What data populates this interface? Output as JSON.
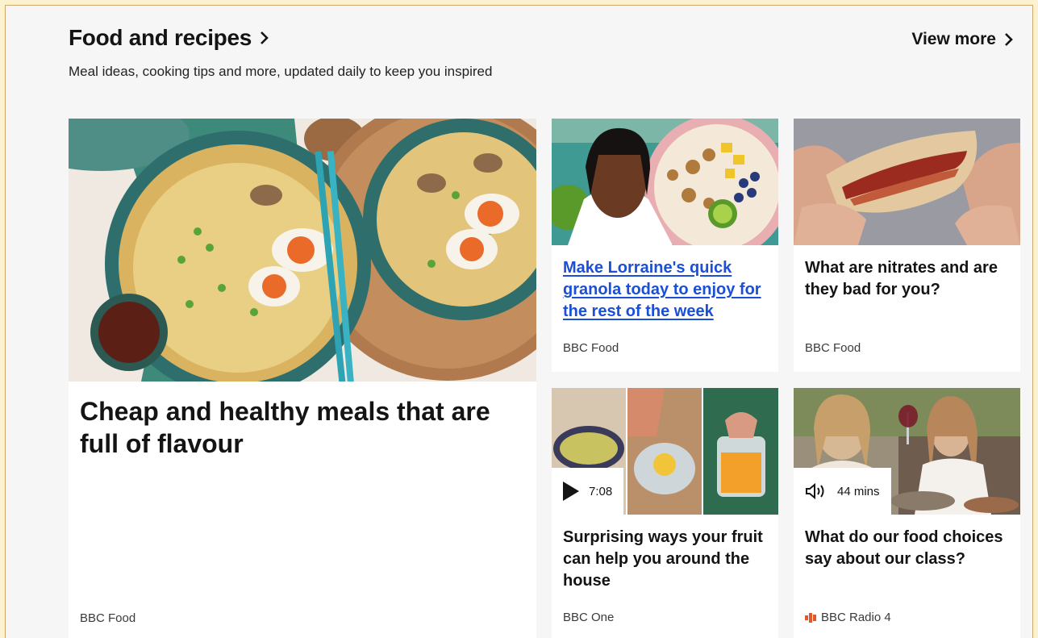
{
  "section": {
    "title": "Food and recipes",
    "subtitle": "Meal ideas, cooking tips and more, updated daily to keep you inspired",
    "view_more": "View more"
  },
  "cards": [
    {
      "headline": "Cheap and healthy meals that are full of flavour",
      "source": "BBC Food",
      "image": "two bowls of ramen with eggs and chopsticks"
    },
    {
      "headline": "Make Lorraine's quick granola today to enjoy for the rest of the week",
      "source": "BBC Food",
      "image": "woman next to a bowl of granola and fruit"
    },
    {
      "headline": "What are nitrates and are they bad for you?",
      "source": "BBC Food",
      "image": "hands holding a bacon sandwich"
    },
    {
      "headline": "Surprising ways your fruit can help you around the house",
      "source": "BBC One",
      "media": "7:08",
      "media_icon": "play-icon",
      "image": "bowls and jars with lemons and orange peel"
    },
    {
      "headline": "What do our food choices say about our class?",
      "source": "BBC Radio 4",
      "media": "44 mins",
      "media_icon": "speaker-icon",
      "source_icon": "bbc-radio-4-icon",
      "image": "women laughing at a restaurant table"
    }
  ],
  "colors": {
    "link": "#1a4fd6",
    "radio_accent": "#e3582a"
  }
}
